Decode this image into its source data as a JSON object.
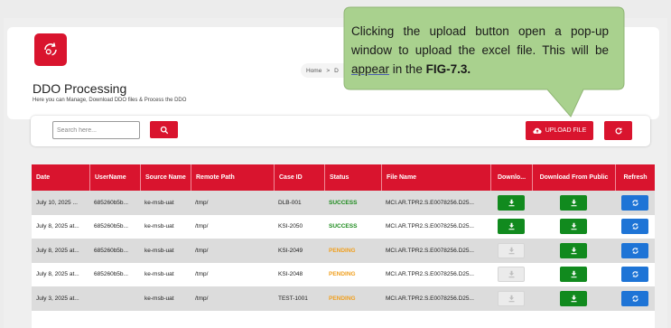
{
  "header": {
    "title": "DDO Processing",
    "subtitle": "Here you can Manage, Download DDO files & Process the DDO",
    "breadcrumb_home": "Home",
    "breadcrumb_sep": ">",
    "breadcrumb_next": "D"
  },
  "search": {
    "placeholder": "Search here..."
  },
  "toolbar": {
    "upload_label": "UPLOAD FILE"
  },
  "table": {
    "columns": [
      "Date",
      "UserName",
      "Source Name",
      "Remote Path",
      "Case ID",
      "Status",
      "File Name",
      "Downlo...",
      "Download From Public",
      "Refresh"
    ],
    "rows": [
      {
        "date": "July 10, 2025 ...",
        "user": "685260b5b...",
        "source": "ke-msb-uat",
        "path": "/tmp/",
        "case": "DLB-001",
        "status": "SUCCESS",
        "file": "MCI.AR.TPR2.S.E0078256.D25..."
      },
      {
        "date": "July 8, 2025 at...",
        "user": "685260b5b...",
        "source": "ke-msb-uat",
        "path": "/tmp/",
        "case": "KSI-2050",
        "status": "SUCCESS",
        "file": "MCI.AR.TPR2.S.E0078256.D25..."
      },
      {
        "date": "July 8, 2025 at...",
        "user": "685260b5b...",
        "source": "ke-msb-uat",
        "path": "/tmp/",
        "case": "KSI-2049",
        "status": "PENDING",
        "file": "MCI.AR.TPR2.S.E0078256.D25..."
      },
      {
        "date": "July 8, 2025 at...",
        "user": "685260b5b...",
        "source": "ke-msb-uat",
        "path": "/tmp/",
        "case": "KSI-2048",
        "status": "PENDING",
        "file": "MCI.AR.TPR2.S.E0078256.D25..."
      },
      {
        "date": "July 3, 2025 at...",
        "user": "",
        "source": "ke-msb-uat",
        "path": "/tmp/",
        "case": "TEST-1001",
        "status": "PENDING",
        "file": "MCI.AR.TPR2.S.E0078256.D25..."
      }
    ]
  },
  "callout": {
    "text_a": "Clicking the upload button open a pop-up window to upload the excel file. This will be ",
    "text_u": "appear",
    "text_b": " in the ",
    "text_fig": "FIG-7.3."
  },
  "colors": {
    "brand_red": "#d9142e",
    "success_green": "#1c8a1c",
    "pending_orange": "#f0a020",
    "download_green": "#118a1e",
    "refresh_blue": "#1e74d6",
    "callout_fill": "#a9d18e"
  },
  "icons": {
    "logo": "gear-refresh-icon",
    "search": "search-icon",
    "upload": "cloud-upload-icon",
    "refresh": "refresh-icon",
    "download": "download-icon",
    "row_refresh": "sync-icon"
  }
}
